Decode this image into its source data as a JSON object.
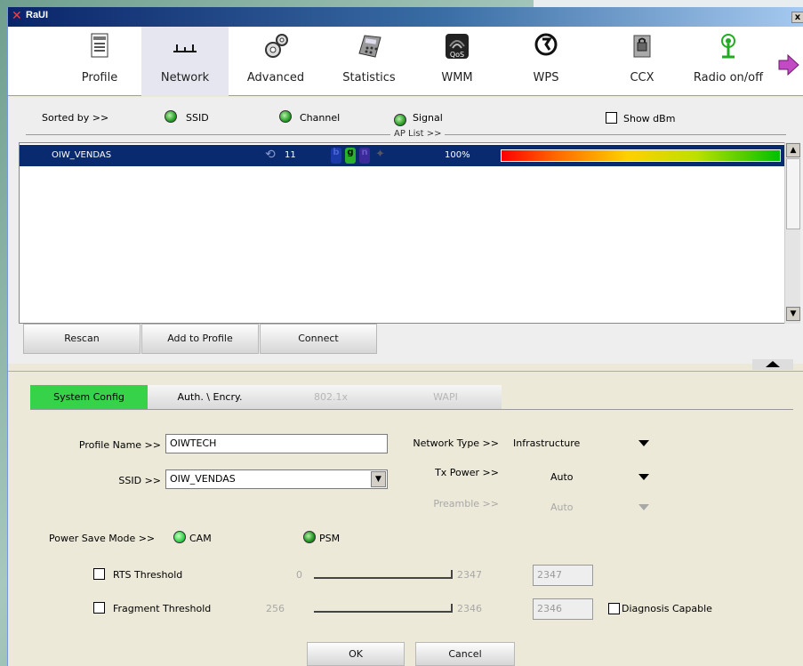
{
  "window": {
    "title": "RaUI",
    "close_label": "x"
  },
  "toolbar": {
    "items": [
      {
        "label": "Profile",
        "icon": "profile-icon"
      },
      {
        "label": "Network",
        "icon": "network-icon"
      },
      {
        "label": "Advanced",
        "icon": "advanced-icon"
      },
      {
        "label": "Statistics",
        "icon": "statistics-icon"
      },
      {
        "label": "WMM",
        "icon": "wmm-icon",
        "badge": "QoS"
      },
      {
        "label": "WPS",
        "icon": "wps-icon"
      },
      {
        "label": "CCX",
        "icon": "ccx-icon"
      },
      {
        "label": "Radio on/off",
        "icon": "radio-icon"
      }
    ],
    "active": "Network"
  },
  "sort": {
    "label": "Sorted by >>",
    "ssid": "SSID",
    "channel": "Channel",
    "signal": "Signal",
    "show_dbm": "Show dBm"
  },
  "aplist": {
    "label": "AP List >>",
    "rows": [
      {
        "ssid": "OIW_VENDAS",
        "channel": "11",
        "mode_badges": [
          "b",
          "g",
          "n"
        ],
        "signal": "100%"
      }
    ]
  },
  "buttons": {
    "rescan": "Rescan",
    "add_profile": "Add to Profile",
    "connect": "Connect",
    "ok": "OK",
    "cancel": "Cancel"
  },
  "tabs": [
    {
      "label": "System Config",
      "state": "active"
    },
    {
      "label": "Auth. \\ Encry.",
      "state": "normal"
    },
    {
      "label": "802.1x",
      "state": "disabled"
    },
    {
      "label": "WAPI",
      "state": "disabled"
    }
  ],
  "config": {
    "profile_name_label": "Profile Name >>",
    "profile_name_value": "OIWTECH",
    "ssid_label": "SSID >>",
    "ssid_value": "OIW_VENDAS",
    "network_type_label": "Network Type >>",
    "network_type_value": "Infrastructure",
    "tx_power_label": "Tx Power >>",
    "tx_power_value": "Auto",
    "preamble_label": "Preamble >>",
    "preamble_value": "Auto",
    "power_save_label": "Power Save Mode >>",
    "cam": "CAM",
    "psm": "PSM",
    "rts_label": "RTS Threshold",
    "rts_min": "0",
    "rts_max": "2347",
    "rts_value": "2347",
    "frag_label": "Fragment Threshold",
    "frag_min": "256",
    "frag_max": "2346",
    "frag_value": "2346",
    "diag_label": "Diagnosis Capable"
  },
  "colors": {
    "accent_green": "#35d24a",
    "selection_blue": "#0a2a70"
  }
}
